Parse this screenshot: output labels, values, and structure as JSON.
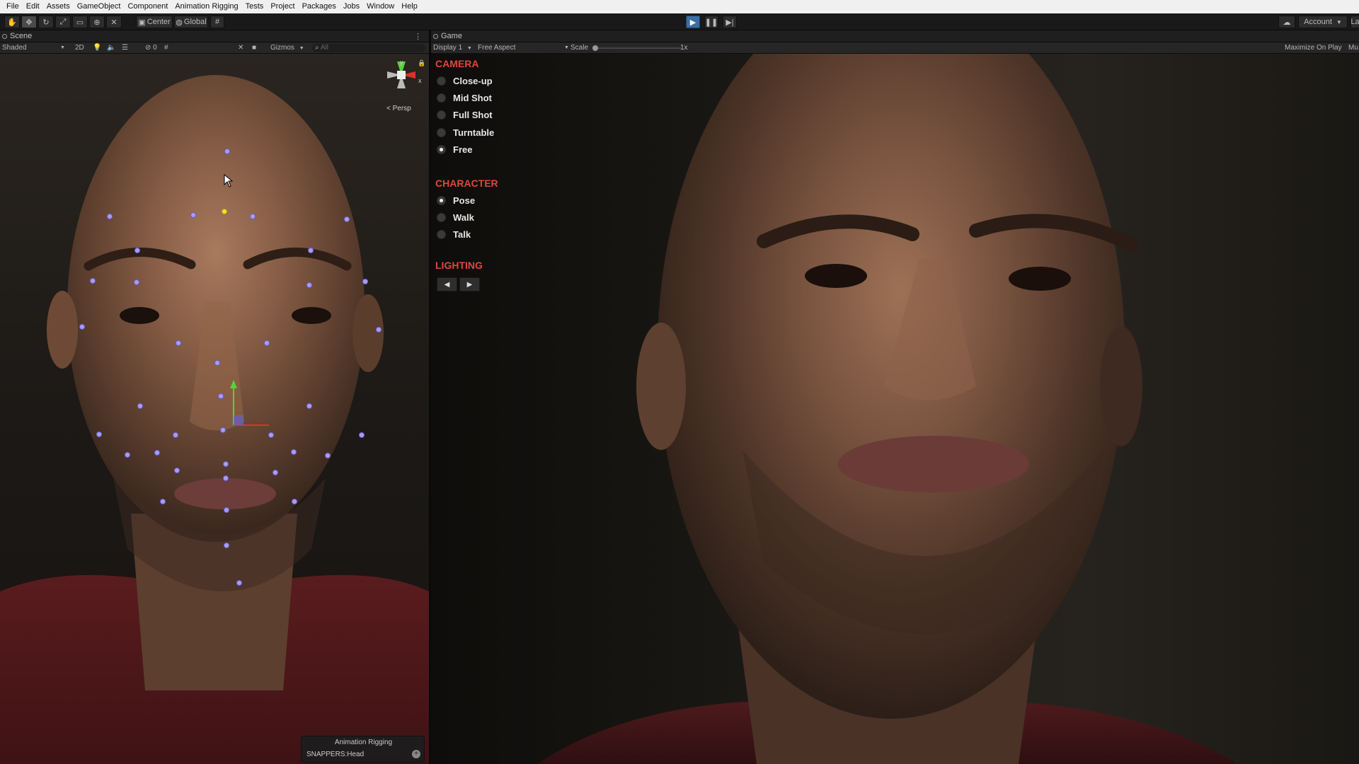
{
  "menubar": {
    "items": [
      "File",
      "Edit",
      "Assets",
      "GameObject",
      "Component",
      "Animation Rigging",
      "Tests",
      "Project",
      "Packages",
      "Jobs",
      "Window",
      "Help"
    ]
  },
  "toolbar": {
    "pivot_label": "Center",
    "space_label": "Global",
    "account_label": "Account",
    "layers_label": "La"
  },
  "scene": {
    "tab_label": "Scene",
    "shading_mode": "Shaded",
    "mode_2d": "2D",
    "gizmos_label": "Gizmos",
    "search_placeholder": "All",
    "hidden_count": "0",
    "persp_label": "< Persp",
    "gizmo_axis_y": "y",
    "gizmo_axis_x": "x"
  },
  "game": {
    "tab_label": "Game",
    "display": "Display 1",
    "aspect": "Free Aspect",
    "scale_label": "Scale",
    "scale_value": "1x",
    "maximize_label": "Maximize On Play",
    "mute_label": "Mu"
  },
  "camera_section": {
    "title": "CAMERA",
    "options": [
      {
        "label": "Close-up",
        "selected": false
      },
      {
        "label": "Mid Shot",
        "selected": false
      },
      {
        "label": "Full Shot",
        "selected": false
      },
      {
        "label": "Turntable",
        "selected": false
      },
      {
        "label": "Free",
        "selected": true
      }
    ]
  },
  "character_section": {
    "title": "CHARACTER",
    "options": [
      {
        "label": "Pose",
        "selected": true
      },
      {
        "label": "Walk",
        "selected": false
      },
      {
        "label": "Talk",
        "selected": false
      }
    ]
  },
  "lighting_section": {
    "title": "LIGHTING",
    "prev_glyph": "◀",
    "next_glyph": "▶"
  },
  "anim_overlay": {
    "title": "Animation Rigging",
    "target": "SNAPPERS:Head"
  },
  "colors": {
    "section_title": "#e0463a",
    "landmark": "#a89cf5",
    "landmark_selected": "#f2e22c",
    "play_active": "#3b6ea5"
  }
}
